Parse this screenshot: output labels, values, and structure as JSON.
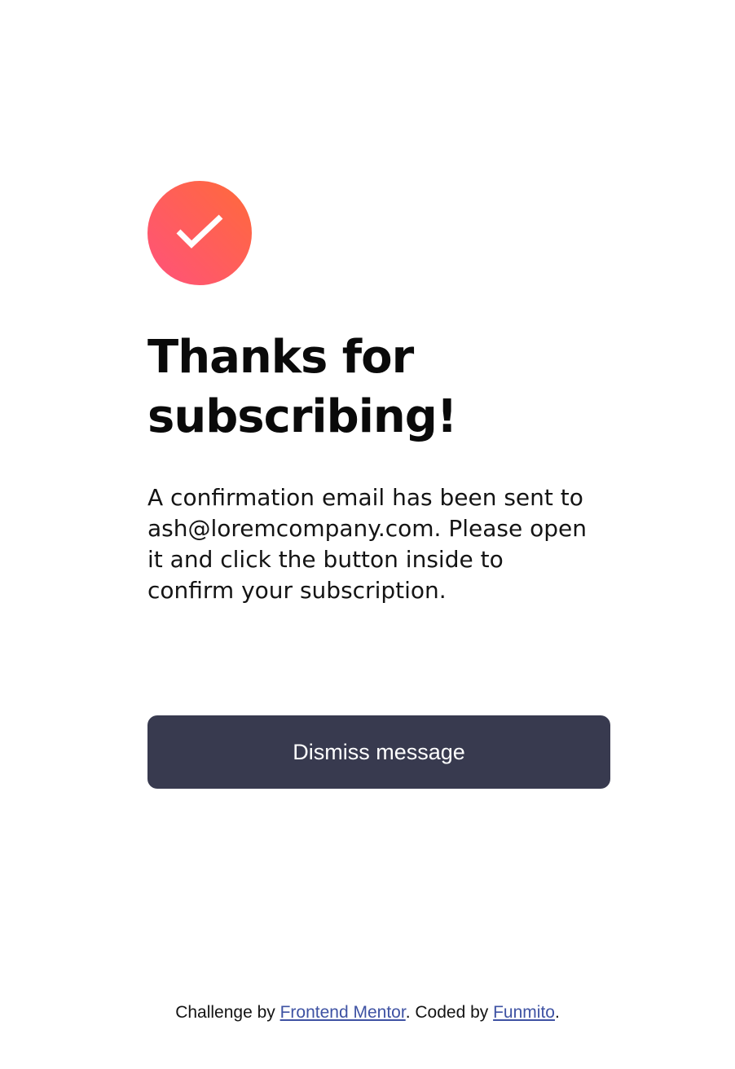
{
  "success": {
    "icon": "checkmark-icon",
    "gradient_start": "#ff6a3a",
    "gradient_end": "#ff527b"
  },
  "title": "Thanks for subscribing!",
  "message": "A confirmation email has been sent to ash@loremcompany.com. Please open it and click the button inside to confirm your subscription.",
  "dismiss": {
    "label": "Dismiss message",
    "color": "#383a4f"
  },
  "footer": {
    "prefix": "Challenge by ",
    "link1": "Frontend Mentor",
    "middle": ". Coded by ",
    "link2": "Funmito",
    "suffix": ".",
    "link_color": "#3e52a3"
  }
}
